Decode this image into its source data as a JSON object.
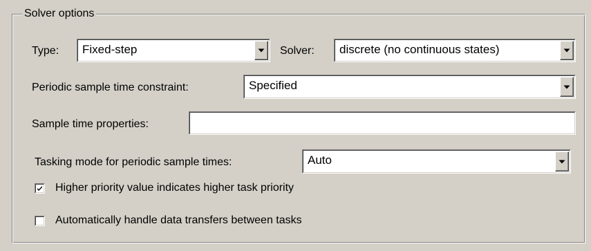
{
  "group": {
    "title": "Solver options"
  },
  "type": {
    "label": "Type:",
    "value": "Fixed-step"
  },
  "solver": {
    "label": "Solver:",
    "value": "discrete (no continuous states)"
  },
  "periodic": {
    "label": "Periodic sample time constraint:",
    "value": "Specified"
  },
  "sample_props": {
    "label": "Sample time properties:",
    "value": ""
  },
  "tasking": {
    "label": "Tasking mode for periodic sample times:",
    "value": "Auto"
  },
  "checkbox_priority": {
    "label": "Higher priority value indicates higher task priority",
    "checked": true
  },
  "checkbox_transfer": {
    "label": "Automatically handle data transfers between tasks",
    "checked": false
  },
  "icons": {
    "dropdown": "chevron-down-icon",
    "check": "check-icon"
  }
}
